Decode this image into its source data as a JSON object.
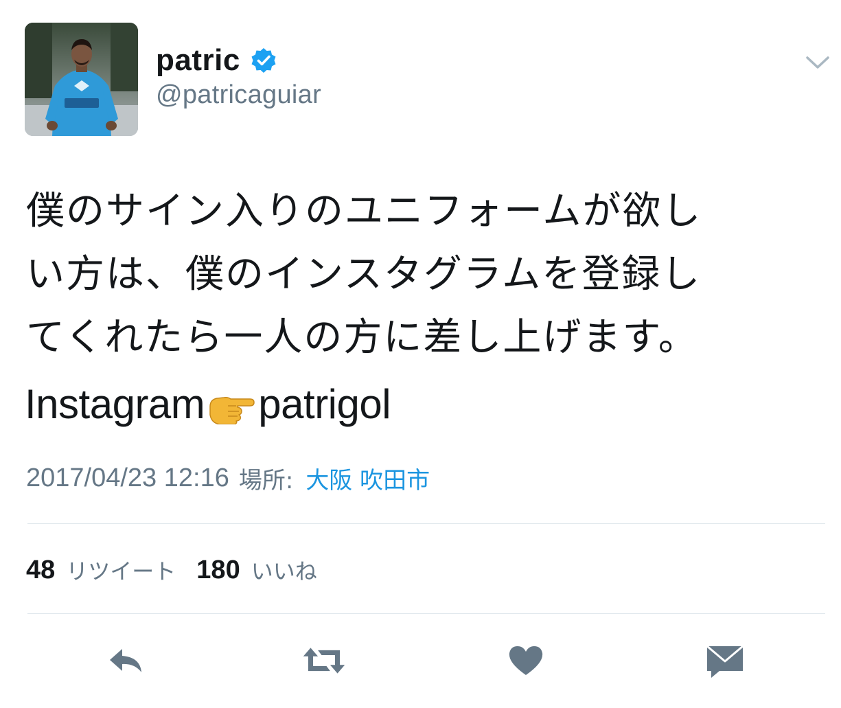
{
  "tweet": {
    "author": {
      "display_name": "patric",
      "handle": "@patricaguiar",
      "verified": true
    },
    "text_lines": [
      "僕のサイン入りのユニフォームが欲し",
      "い方は、僕のインスタグラムを登録し",
      "てくれたら一人の方に差し上げます。"
    ],
    "instagram_prefix": "Instagram",
    "instagram_emoji": "backhand-index-pointing-right",
    "instagram_handle": "patrigol",
    "timestamp": "2017/04/23 12:16",
    "location_label": "場所:",
    "location": "大阪 吹田市",
    "stats": {
      "retweets_count": "48",
      "retweets_label": "リツイート",
      "likes_count": "180",
      "likes_label": "いいね"
    }
  },
  "icons": {
    "menu": "chevron-down-icon",
    "verified": "verified-badge-icon",
    "reply": "reply-icon",
    "retweet": "retweet-icon",
    "like": "heart-icon",
    "dm": "envelope-icon"
  },
  "colors": {
    "text": "#14171a",
    "secondary": "#657786",
    "link": "#1b95e0",
    "verified": "#1da1f2",
    "divider": "#e1e8ed",
    "icon": "#657786"
  }
}
